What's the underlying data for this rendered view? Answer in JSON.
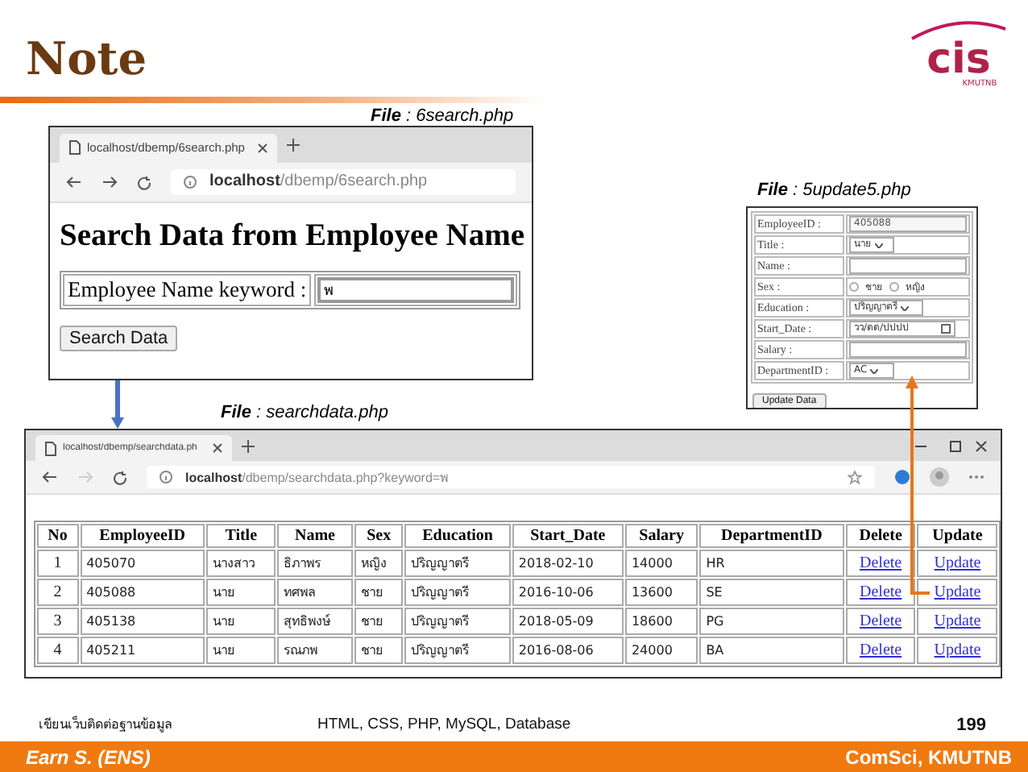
{
  "slide": {
    "title": "Note",
    "logo": {
      "mark": "cis",
      "subtitle": "KMUTNB"
    }
  },
  "search_window": {
    "caption": "**File** : 6search.php",
    "tab_title": "localhost/dbemp/6search.php",
    "forward_disabled": false,
    "address_host": "localhost",
    "address_path": "/dbemp/6search.php",
    "heading": "Search Data from Employee Name",
    "field_label": "Employee Name keyword :",
    "field_value": "พ",
    "button": "Search Data"
  },
  "results_window": {
    "caption": "**File** : searchdata.php",
    "tab_title": "localhost/dbemp/searchdata.ph",
    "forward_disabled": true,
    "address_host": "localhost",
    "address_path": "/dbemp/searchdata.php?keyword=พ",
    "table": {
      "columns": [
        "No",
        "EmployeeID",
        "Title",
        "Name",
        "Sex",
        "Education",
        "Start_Date",
        "Salary",
        "DepartmentID",
        "Delete",
        "Update"
      ],
      "rows": [
        {
          "cells": [
            "1",
            "405070",
            "นางสาว",
            "ธิภาพร",
            "หญิง",
            "ปริญญาตรี",
            "2018-02-10",
            "14000",
            "HR"
          ],
          "actions": [
            "Delete",
            "Update"
          ]
        },
        {
          "cells": [
            "2",
            "405088",
            "นาย",
            "ทศพล",
            "ชาย",
            "ปริญญาตรี",
            "2016-10-06",
            "13600",
            "SE"
          ],
          "actions": [
            "Delete",
            "Update"
          ]
        },
        {
          "cells": [
            "3",
            "405138",
            "นาย",
            "สุทธิพงษ์",
            "ชาย",
            "ปริญญาตรี",
            "2018-05-09",
            "18600",
            "PG"
          ],
          "actions": [
            "Delete",
            "Update"
          ]
        },
        {
          "cells": [
            "4",
            "405211",
            "นาย",
            "รณภพ",
            "ชาย",
            "ปริญญาตรี",
            "2016-08-06",
            "24000",
            "BA"
          ],
          "actions": [
            "Delete",
            "Update"
          ]
        }
      ]
    }
  },
  "update_window": {
    "caption": "**File** : 5update5.php",
    "fields": [
      {
        "label": "EmployeeID :",
        "kind": "readonly",
        "value": "405088"
      },
      {
        "label": "Title :",
        "kind": "select",
        "value": "นาย"
      },
      {
        "label": "Name :",
        "kind": "text"
      },
      {
        "label": "Sex :",
        "kind": "radio",
        "options": [
          {
            "label": "ชาย",
            "checked": false
          },
          {
            "label": "หญิง",
            "checked": false
          }
        ]
      },
      {
        "label": "Education :",
        "kind": "select",
        "value": "ปริญญาตรี"
      },
      {
        "label": "Start_Date :",
        "kind": "date",
        "placeholder": "วว/ดด/ปปปป"
      },
      {
        "label": "Salary :",
        "kind": "text"
      },
      {
        "label": "DepartmentID :",
        "kind": "select",
        "value": "AC"
      }
    ],
    "button": "Update Data"
  },
  "footer": {
    "subject": "เขียนเว็บติดต่อฐานข้อมูล",
    "topics": "HTML, CSS, PHP, MySQL, Database",
    "page": "199",
    "author": "Earn S. (ENS)",
    "org": "ComSci, KMUTNB"
  }
}
